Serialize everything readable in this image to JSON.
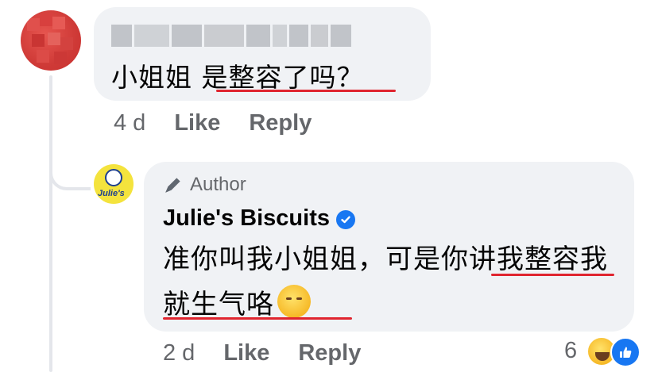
{
  "comment_1": {
    "text": "小姐姐 是整容了吗？",
    "time": "4 d",
    "like_label": "Like",
    "reply_label": "Reply"
  },
  "reply_1": {
    "role_label": "Author",
    "author_name": "Julie's Biscuits",
    "avatar_text": "Julie's",
    "text": "准你叫我小姐姐，可是你讲我整容我就生气咯",
    "time": "2 d",
    "like_label": "Like",
    "reply_label": "Reply",
    "reaction_count": "6",
    "reactions": [
      "laugh-emoji",
      "like-icon"
    ]
  },
  "colors": {
    "bubble": "#f0f2f5",
    "meta_text": "#65676b",
    "verified": "#1877f2",
    "underline": "#e0252f"
  }
}
